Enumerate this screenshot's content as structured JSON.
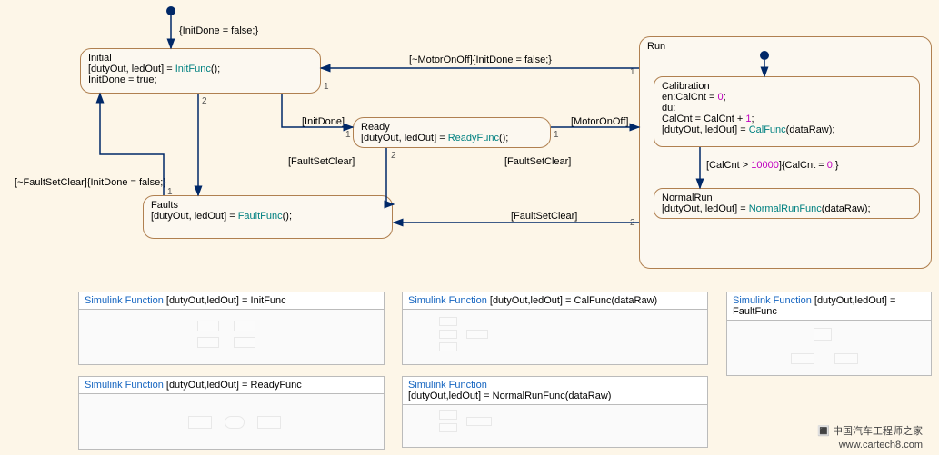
{
  "init_action": "{InitDone = false;}",
  "states": {
    "initial": {
      "name": "Initial",
      "l1a": "[dutyOut, ledOut] = ",
      "l1b": "InitFunc",
      "l1c": "();",
      "l2": "InitDone = true;"
    },
    "ready": {
      "name": "Ready",
      "l1a": "[dutyOut, ledOut] = ",
      "l1b": "ReadyFunc",
      "l1c": "();"
    },
    "faults": {
      "name": "Faults",
      "l1a": "[dutyOut, ledOut] = ",
      "l1b": "FaultFunc",
      "l1c": "();"
    },
    "run": {
      "name": "Run"
    },
    "calibration": {
      "name": "Calibration",
      "l1": "en:CalCnt = ",
      "l1n": "0",
      "l1e": ";",
      "l2": "du:",
      "l3": "CalCnt = CalCnt + ",
      "l3n": "1",
      "l3e": ";",
      "l4a": "[dutyOut, ledOut] = ",
      "l4b": "CalFunc",
      "l4c": "(dataRaw);"
    },
    "normalrun": {
      "name": "NormalRun",
      "l1a": "[dutyOut, ledOut] = ",
      "l1b": "NormalRunFunc",
      "l1c": "(dataRaw);"
    }
  },
  "trans": {
    "t1": "[~MotorOnOff]{InitDone = false;}",
    "t2": "[InitDone]",
    "t3": "[MotorOnOff]",
    "t4": "[FaultSetClear]",
    "t5": "[FaultSetClear]",
    "t6": "[FaultSetClear]",
    "t7": "[~FaultSetClear]{InitDone = false;}",
    "t8a": "[CalCnt > ",
    "t8n": "10000",
    "t8b": "]{CalCnt = ",
    "t8n2": "0",
    "t8c": ";}"
  },
  "prio": {
    "p1": "1",
    "p2": "2"
  },
  "simfuncs": {
    "prefix": "Simulink Function",
    "f1": "  [dutyOut,ledOut] = InitFunc",
    "f2": "  [dutyOut,ledOut] = ReadyFunc",
    "f3": "  [dutyOut,ledOut] = CalFunc(dataRaw)",
    "f4": "[dutyOut,ledOut] = NormalRunFunc(dataRaw)",
    "f5": "  [dutyOut,ledOut] = FaultFunc"
  },
  "watermark": {
    "l2": "www.cartech8.com"
  }
}
